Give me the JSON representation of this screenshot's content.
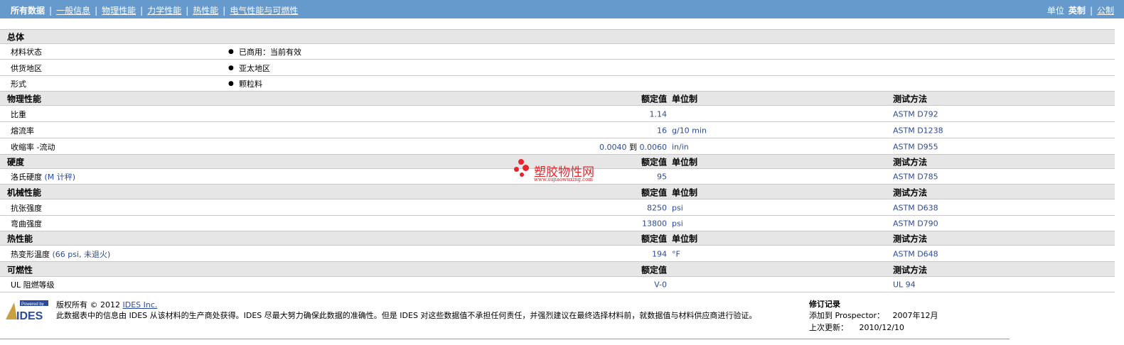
{
  "nav": {
    "tabs": [
      {
        "label": "所有数据",
        "active": true
      },
      {
        "label": "一般信息",
        "active": false
      },
      {
        "label": "物理性能",
        "active": false
      },
      {
        "label": "力学性能",
        "active": false
      },
      {
        "label": "热性能",
        "active": false
      },
      {
        "label": "电气性能与可燃性",
        "active": false
      }
    ],
    "units_label": "单位",
    "units_current": "英制",
    "units_other": "公制"
  },
  "general": {
    "title": "总体",
    "rows": [
      {
        "label": "材料状态",
        "value": "已商用：当前有效"
      },
      {
        "label": "供货地区",
        "value": "亚太地区"
      },
      {
        "label": "形式",
        "value": "颗粒料"
      }
    ]
  },
  "col_headers": {
    "nominal": "额定值",
    "unit": "单位制",
    "method": "测试方法"
  },
  "sections": [
    {
      "title": "物理性能",
      "rows": [
        {
          "label": "比重",
          "value": "1.14",
          "unit": "",
          "method": "ASTM D792"
        },
        {
          "label": "熔流率",
          "value": "16",
          "unit": "g/10 min",
          "method": "ASTM D1238"
        },
        {
          "label": "收缩率 -流动",
          "value_from": "0.0040",
          "value_to_word": "到",
          "value_to": "0.0060",
          "unit": "in/in",
          "method": "ASTM D955"
        }
      ]
    },
    {
      "title": "硬度",
      "rows": [
        {
          "label": "洛氏硬度",
          "label_note": "(M 计秤)",
          "value": "95",
          "unit": "",
          "method": "ASTM D785"
        }
      ]
    },
    {
      "title": "机械性能",
      "rows": [
        {
          "label": "抗张强度",
          "value": "8250",
          "unit": "psi",
          "method": "ASTM D638"
        },
        {
          "label": "弯曲强度",
          "value": "13800",
          "unit": "psi",
          "method": "ASTM D790"
        }
      ]
    },
    {
      "title": "热性能",
      "rows": [
        {
          "label": "热变形温度",
          "label_note": "(66 psi, 未退火)",
          "value": "194",
          "unit": "°F",
          "method": "ASTM D648"
        }
      ]
    },
    {
      "title": "可燃性",
      "rows": [
        {
          "label": "UL 阻燃等级",
          "value": "V-0",
          "unit": "",
          "method": "UL 94"
        }
      ]
    }
  ],
  "watermark": {
    "text": "塑胶物性网",
    "url": "www.sujiaowuxing.com"
  },
  "footer": {
    "logo_top": "Powered by",
    "logo_main": "IDES",
    "copyright_prefix": "版权所有 © 2012",
    "copyright_link": "IDES Inc.",
    "disclaimer": "此数据表中的信息由 IDES 从该材料的生产商处获得。IDES 尽最大努力确保此数据的准确性。但是 IDES 对这些数据值不承担任何责任，并强烈建议在最终选择材料前，就数据值与材料供应商进行验证。",
    "revision_title": "修订记录",
    "added_label": "添加到 Prospector：",
    "added_value": "2007年12月",
    "updated_label": "上次更新：",
    "updated_value": "2010/12/10"
  },
  "colors": {
    "topbar": "#6699cc",
    "section_bg": "#e6e6e6",
    "value_blue": "#2b4b9a",
    "watermark_red": "#e8242a"
  }
}
